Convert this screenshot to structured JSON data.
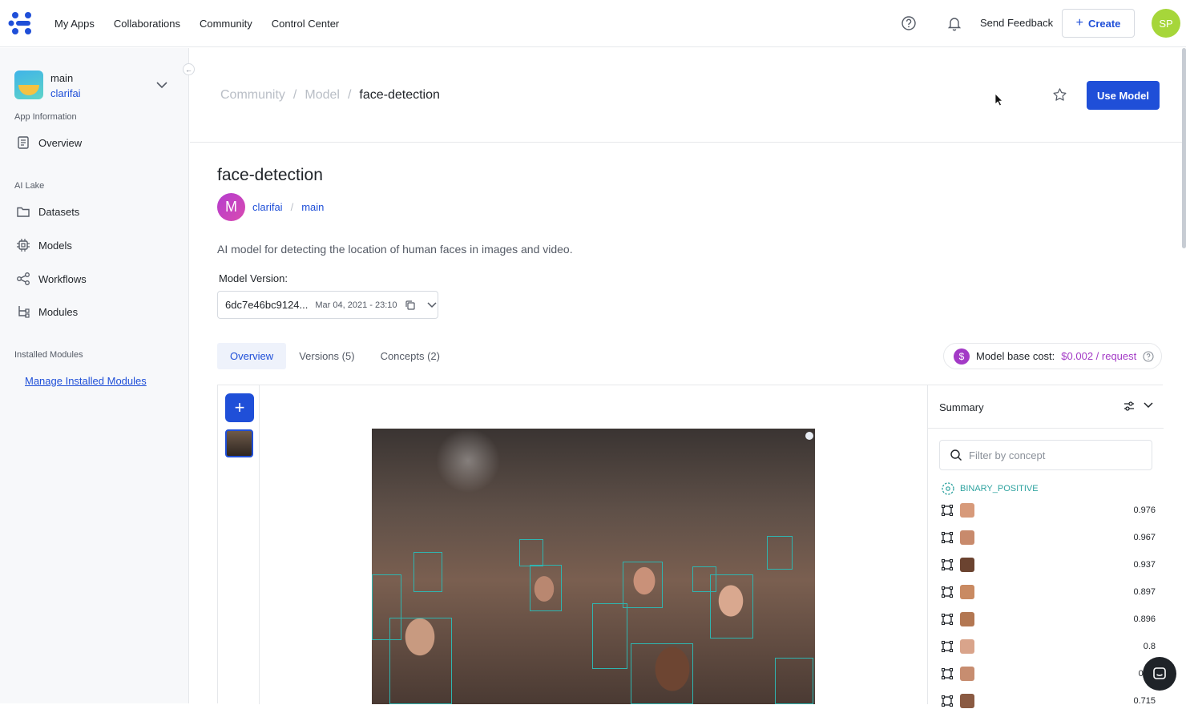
{
  "topnav": {
    "items": [
      "My Apps",
      "Collaborations",
      "Community",
      "Control Center"
    ],
    "feedback_label": "Send Feedback",
    "create_label": "Create",
    "user_initials": "SP"
  },
  "sidebar": {
    "app_name": "main",
    "app_owner": "clarifai",
    "section_app_info": "App Information",
    "overview_label": "Overview",
    "section_ai_lake": "AI Lake",
    "datasets_label": "Datasets",
    "models_label": "Models",
    "workflows_label": "Workflows",
    "modules_label": "Modules",
    "section_installed": "Installed Modules",
    "manage_label": "Manage Installed Modules"
  },
  "breadcrumb": {
    "items": [
      "Community",
      "Model",
      "face-detection"
    ],
    "separator": "/"
  },
  "header": {
    "use_model_label": "Use Model"
  },
  "model": {
    "title": "face-detection",
    "owner_initial": "M",
    "owner": "clarifai",
    "app": "main",
    "separator": "/",
    "description": "AI model for detecting the location of human faces in images and video.",
    "version_label": "Model Version:",
    "version_id": "6dc7e46bc9124...",
    "version_date": "Mar 04, 2021 - 23:10"
  },
  "tabs": [
    "Overview",
    "Versions (5)",
    "Concepts (2)"
  ],
  "cost": {
    "symbol": "$",
    "label": "Model base cost:",
    "value": "$0.002 / request"
  },
  "workspace": {
    "add_symbol": "+"
  },
  "summary": {
    "title": "Summary",
    "filter_placeholder": "Filter by concept",
    "concept": "BINARY_POSITIVE",
    "regions": [
      "0.976",
      "0.967",
      "0.937",
      "0.897",
      "0.896",
      "0.8",
      "0.75",
      "0.715"
    ]
  },
  "colors": {
    "accent": "#1f4fd8",
    "cost": "#a33ac6",
    "bbox": "#2fb5b0"
  }
}
